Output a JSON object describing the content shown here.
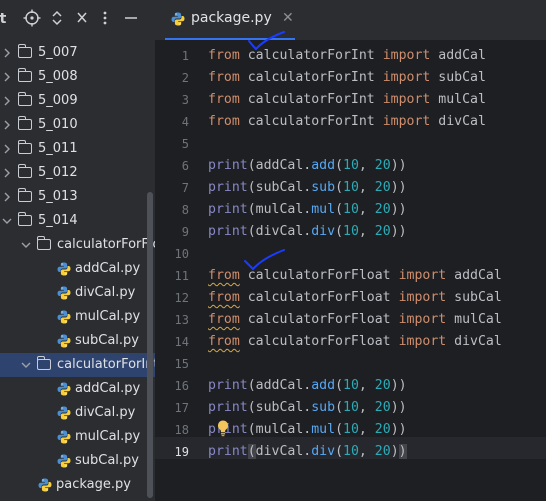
{
  "sidebar": {
    "toolbar": {
      "title_fragment": "t",
      "locate_icon": "⌖",
      "expand_collapse_icon": "⌃⌄",
      "close_icon": "✕",
      "more_icon": "⋮",
      "minimize_icon": "—"
    },
    "tree": [
      {
        "label": "5_007",
        "type": "folder",
        "expanded": false
      },
      {
        "label": "5_008",
        "type": "folder",
        "expanded": false
      },
      {
        "label": "5_009",
        "type": "folder",
        "expanded": false
      },
      {
        "label": "5_010",
        "type": "folder",
        "expanded": false
      },
      {
        "label": "5_011",
        "type": "folder",
        "expanded": false
      },
      {
        "label": "5_012",
        "type": "folder",
        "expanded": false
      },
      {
        "label": "5_013",
        "type": "folder",
        "expanded": false
      },
      {
        "label": "5_014",
        "type": "folder",
        "expanded": true
      },
      {
        "label": "calculatorForFlo",
        "type": "folder",
        "expanded": true
      },
      {
        "label": "addCal.py",
        "type": "file"
      },
      {
        "label": "divCal.py",
        "type": "file"
      },
      {
        "label": "mulCal.py",
        "type": "file"
      },
      {
        "label": "subCal.py",
        "type": "file"
      },
      {
        "label": "calculatorForInt",
        "type": "folder",
        "expanded": true,
        "selected": true
      },
      {
        "label": "addCal.py",
        "type": "file"
      },
      {
        "label": "divCal.py",
        "type": "file"
      },
      {
        "label": "mulCal.py",
        "type": "file"
      },
      {
        "label": "subCal.py",
        "type": "file"
      },
      {
        "label": "package.py",
        "type": "file"
      }
    ]
  },
  "editor": {
    "tab": {
      "label": "package.py",
      "close_icon": "✕",
      "active": true
    },
    "current_line": 19,
    "lines": [
      {
        "n": "1",
        "tokens": [
          [
            "kw",
            "from"
          ],
          [
            "t",
            " calculatorForInt "
          ],
          [
            "kw",
            "import"
          ],
          [
            "t",
            " addCal"
          ]
        ]
      },
      {
        "n": "2",
        "tokens": [
          [
            "kw",
            "from"
          ],
          [
            "t",
            " calculatorForInt "
          ],
          [
            "kw",
            "import"
          ],
          [
            "t",
            " subCal"
          ]
        ]
      },
      {
        "n": "3",
        "tokens": [
          [
            "kw",
            "from"
          ],
          [
            "t",
            " calculatorForInt "
          ],
          [
            "kw",
            "import"
          ],
          [
            "t",
            " mulCal"
          ]
        ]
      },
      {
        "n": "4",
        "tokens": [
          [
            "kw",
            "from"
          ],
          [
            "t",
            " calculatorForInt "
          ],
          [
            "kw",
            "import"
          ],
          [
            "t",
            " divCal"
          ]
        ]
      },
      {
        "n": "5",
        "tokens": []
      },
      {
        "n": "6",
        "tokens": [
          [
            "pr",
            "print"
          ],
          [
            "t",
            "(addCal."
          ],
          [
            "fn",
            "add"
          ],
          [
            "t",
            "("
          ],
          [
            "num",
            "10"
          ],
          [
            "t",
            ", "
          ],
          [
            "num",
            "20"
          ],
          [
            "t",
            "))"
          ]
        ]
      },
      {
        "n": "7",
        "tokens": [
          [
            "pr",
            "print"
          ],
          [
            "t",
            "(subCal."
          ],
          [
            "fn",
            "sub"
          ],
          [
            "t",
            "("
          ],
          [
            "num",
            "10"
          ],
          [
            "t",
            ", "
          ],
          [
            "num",
            "20"
          ],
          [
            "t",
            "))"
          ]
        ]
      },
      {
        "n": "8",
        "tokens": [
          [
            "pr",
            "print"
          ],
          [
            "t",
            "(mulCal."
          ],
          [
            "fn",
            "mul"
          ],
          [
            "t",
            "("
          ],
          [
            "num",
            "10"
          ],
          [
            "t",
            ", "
          ],
          [
            "num",
            "20"
          ],
          [
            "t",
            "))"
          ]
        ]
      },
      {
        "n": "9",
        "tokens": [
          [
            "pr",
            "print"
          ],
          [
            "t",
            "(divCal."
          ],
          [
            "fn",
            "div"
          ],
          [
            "t",
            "("
          ],
          [
            "num",
            "10"
          ],
          [
            "t",
            ", "
          ],
          [
            "num",
            "20"
          ],
          [
            "t",
            "))"
          ]
        ]
      },
      {
        "n": "10",
        "tokens": []
      },
      {
        "n": "11",
        "tokens": [
          [
            "kwsq",
            "from"
          ],
          [
            "t",
            " calculatorForFloat "
          ],
          [
            "kw",
            "import"
          ],
          [
            "t",
            " addCal"
          ]
        ]
      },
      {
        "n": "12",
        "tokens": [
          [
            "kwsq",
            "from"
          ],
          [
            "t",
            " calculatorForFloat "
          ],
          [
            "kw",
            "import"
          ],
          [
            "t",
            " subCal"
          ]
        ]
      },
      {
        "n": "13",
        "tokens": [
          [
            "kwsq",
            "from"
          ],
          [
            "t",
            " calculatorForFloat "
          ],
          [
            "kw",
            "import"
          ],
          [
            "t",
            " mulCal"
          ]
        ]
      },
      {
        "n": "14",
        "tokens": [
          [
            "kwsq",
            "from"
          ],
          [
            "t",
            " calculatorForFloat "
          ],
          [
            "kw",
            "import"
          ],
          [
            "t",
            " divCal"
          ]
        ]
      },
      {
        "n": "15",
        "tokens": []
      },
      {
        "n": "16",
        "tokens": [
          [
            "pr",
            "print"
          ],
          [
            "t",
            "(addCal."
          ],
          [
            "fn",
            "add"
          ],
          [
            "t",
            "("
          ],
          [
            "num",
            "10"
          ],
          [
            "t",
            ", "
          ],
          [
            "num",
            "20"
          ],
          [
            "t",
            "))"
          ]
        ]
      },
      {
        "n": "17",
        "tokens": [
          [
            "pr",
            "print"
          ],
          [
            "t",
            "(subCal."
          ],
          [
            "fn",
            "sub"
          ],
          [
            "t",
            "("
          ],
          [
            "num",
            "10"
          ],
          [
            "t",
            ", "
          ],
          [
            "num",
            "20"
          ],
          [
            "t",
            "))"
          ]
        ]
      },
      {
        "n": "18",
        "tokens": [
          [
            "pr",
            "print"
          ],
          [
            "t",
            "(mulCal."
          ],
          [
            "fn",
            "mul"
          ],
          [
            "t",
            "("
          ],
          [
            "num",
            "10"
          ],
          [
            "t",
            ", "
          ],
          [
            "num",
            "20"
          ],
          [
            "t",
            "))"
          ]
        ]
      },
      {
        "n": "19",
        "tokens": [
          [
            "pr",
            "print"
          ],
          [
            "hl",
            "("
          ],
          [
            "t",
            "divCal."
          ],
          [
            "fn",
            "div"
          ],
          [
            "t",
            "("
          ],
          [
            "num",
            "10"
          ],
          [
            "t",
            ", "
          ],
          [
            "num",
            "20"
          ],
          [
            "t",
            ")"
          ],
          [
            "hl",
            ")"
          ]
        ]
      }
    ]
  },
  "colors": {
    "keyword": "#cf8e6d",
    "function": "#56a8f5",
    "number": "#2aacb8",
    "builtin": "#8888c6",
    "text": "#bcbec4",
    "selection": "#2e436e",
    "accent": "#3574f0",
    "annotation": "#1a3cff"
  }
}
